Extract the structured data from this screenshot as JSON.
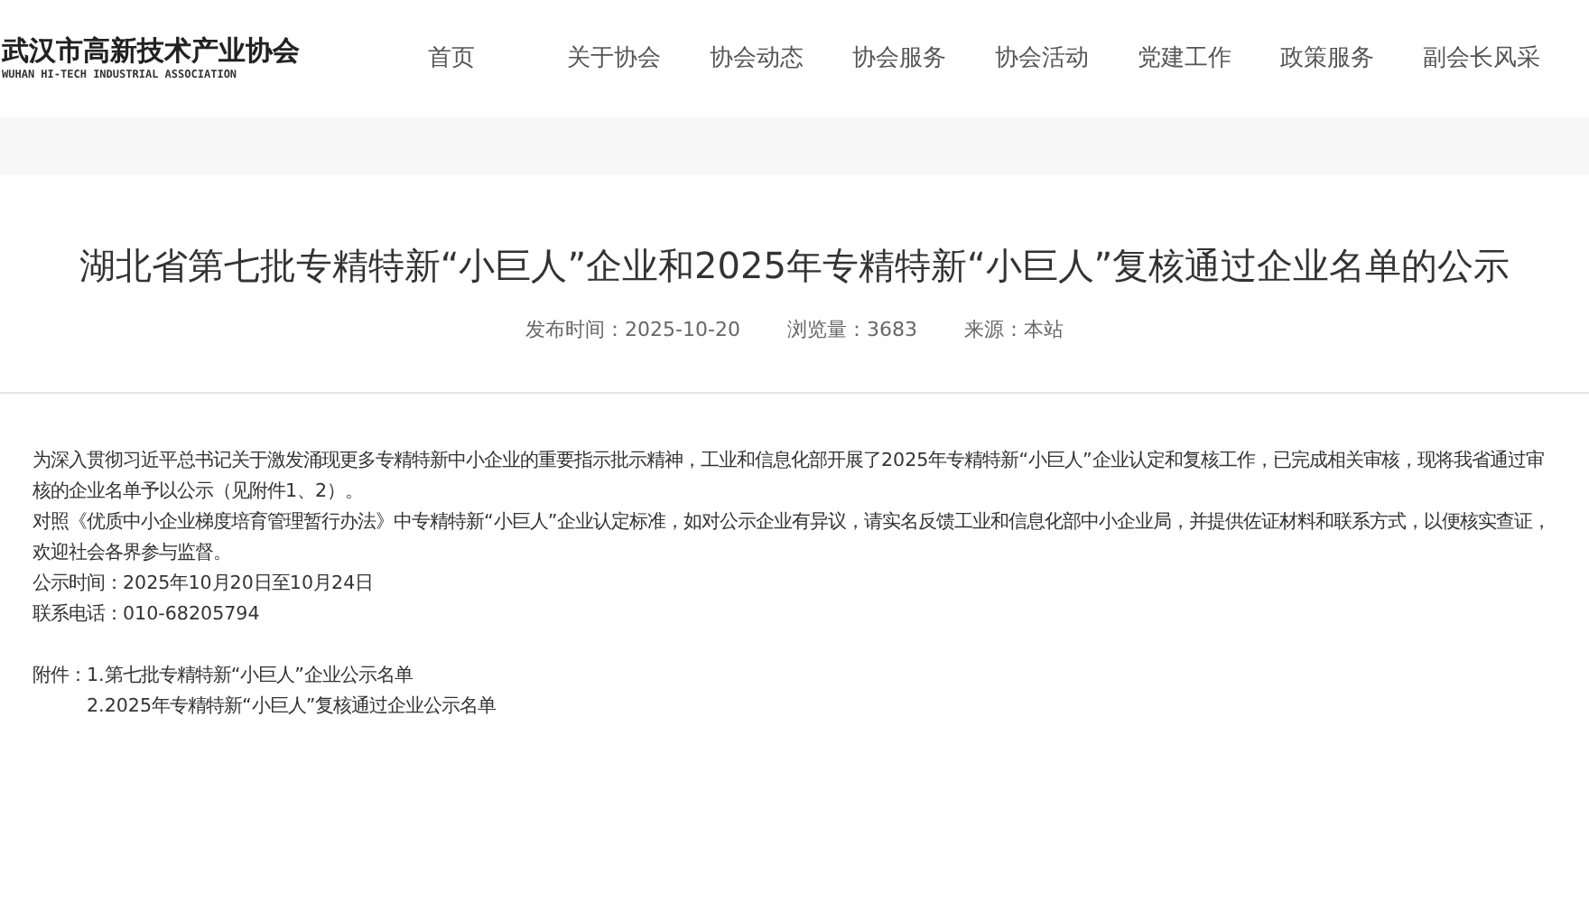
{
  "logo": {
    "name": "武汉市高新技术产业协会",
    "english": "WUHAN HI-TECH INDUSTRIAL ASSOCIATION"
  },
  "nav": [
    {
      "label": "首页"
    },
    {
      "label": "关于协会"
    },
    {
      "label": "协会动态"
    },
    {
      "label": "协会服务"
    },
    {
      "label": "协会活动"
    },
    {
      "label": "党建工作"
    },
    {
      "label": "政策服务"
    },
    {
      "label": "副会长风采"
    }
  ],
  "article": {
    "title": "湖北省第七批专精特新“小巨人”企业和2025年专精特新“小巨人”复核通过企业名单的公示",
    "meta": [
      "发布时间：2025-10-20",
      "浏览量：3683",
      "来源：本站"
    ],
    "paragraphs": [
      "为深入贯彻习近平总书记关于激发涌现更多专精特新中小企业的重要指示批示精神，工业和信息化部开展了2025年专精特新“小巨人”企业认定和复核工作，已完成相关审核，现将我省通过审核的企业名单予以公示（见附件1、2）。",
      "对照《优质中小企业梯度培育管理暂行办法》中专精特新“小巨人”企业认定标准，如对公示企业有异议，请实名反馈工业和信息化部中小企业局，并提供佐证材料和联系方式，以便核实查证，欢迎社会各界参与监督。",
      "公示时间：2025年10月20日至10月24日",
      "联系电话：010-68205794"
    ],
    "attachments_label": "附件：",
    "attachments": [
      "1.第七批专精特新“小巨人”企业公示名单",
      "2.2025年专精特新“小巨人”复核通过企业公示名单"
    ]
  }
}
